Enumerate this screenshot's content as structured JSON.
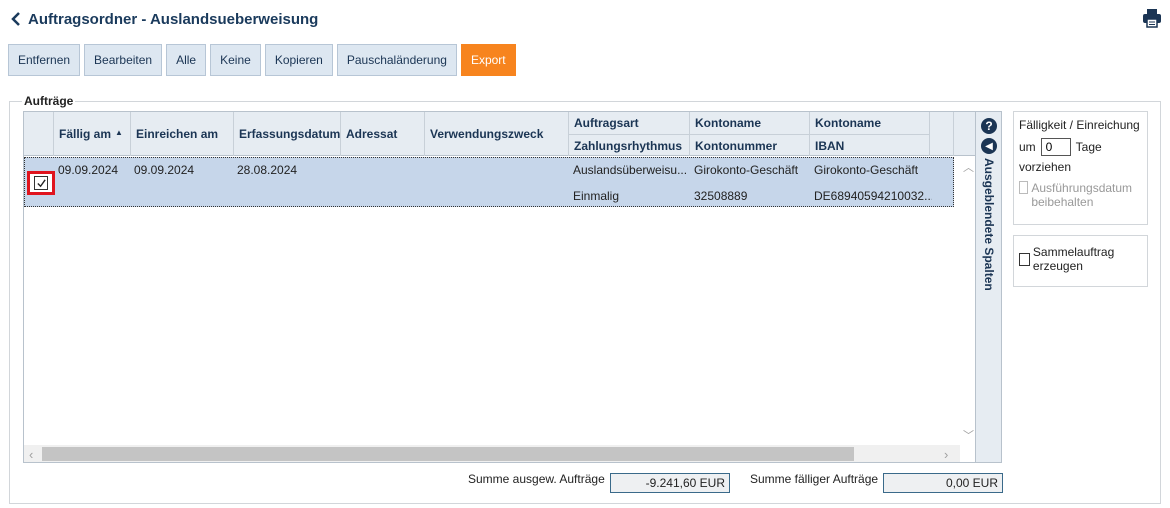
{
  "header": {
    "title": "Auftragsordner - Auslandsueberweisung"
  },
  "toolbar": {
    "buttons": [
      "Entfernen",
      "Bearbeiten",
      "Alle",
      "Keine",
      "Kopieren",
      "Pauschaländerung",
      "Export"
    ]
  },
  "group": {
    "label": "Aufträge"
  },
  "grid": {
    "columns": {
      "faellig": "Fällig am",
      "einreichen": "Einreichen am",
      "erfassung": "Erfassungsdatum",
      "adressat": "Adressat",
      "verwendung": "Verwendungszweck",
      "auftragsart": "Auftragsart",
      "zahlungsrhythmus": "Zahlungsrhythmus",
      "kontoname1": "Kontoname",
      "kontonummer": "Kontonummer",
      "kontoname2": "Kontoname",
      "iban": "IBAN"
    },
    "sort_indicator": "▲",
    "rows": [
      {
        "faellig": "09.09.2024",
        "einreichen": "09.09.2024",
        "erfassung": "28.08.2024",
        "auftragsart": "Auslandsüberweisu...",
        "zahlungsrhythmus": "Einmalig",
        "kontoname1": "Girokonto-Geschäft",
        "kontonummer": "32508889",
        "kontoname2": "Girokonto-Geschäft",
        "iban": "DE68940594210032..."
      }
    ]
  },
  "side": {
    "hidden_columns": "Ausgeblendete Spalten"
  },
  "options": {
    "faelligkeit_title": "Fälligkeit / Einreichung",
    "um": "um",
    "tage_value": "0",
    "tage": "Tage",
    "vorziehen": "vorziehen",
    "ausfuehrung": "Ausführungsdatum beibehalten",
    "sammel": "Sammelauftrag erzeugen"
  },
  "footer": {
    "summe_ausgew_label": "Summe ausgew. Aufträge",
    "summe_ausgew_value": "-9.241,60 EUR",
    "summe_faellig_label": "Summe fälliger Aufträge",
    "summe_faellig_value": "0,00 EUR"
  }
}
